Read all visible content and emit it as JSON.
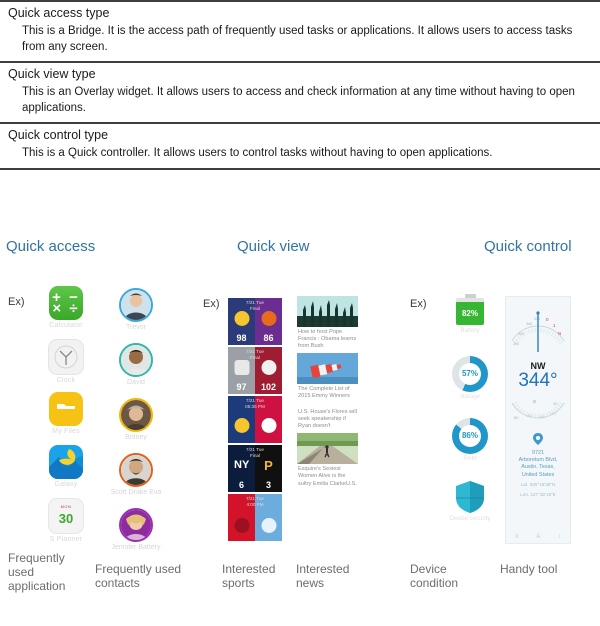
{
  "type_table": {
    "rows": [
      {
        "title": "Quick access type",
        "desc": "This is a Bridge. It is the access path of frequently used tasks or applications. It allows users to access tasks from any screen."
      },
      {
        "title": "Quick view type",
        "desc": "This is an Overlay widget. It allows users to access and check information at any time without having to open applications."
      },
      {
        "title": "Quick control type",
        "desc": "This is a Quick controller. It allows users to control tasks without having to open applications."
      }
    ]
  },
  "headings": {
    "quick_access": "Quick access",
    "quick_view": "Quick view",
    "quick_control": "Quick control"
  },
  "example_labels": {
    "access": "Ex)",
    "view": "Ex)",
    "control": "Ex)"
  },
  "colors": {
    "heading_blue": "#2e75a3",
    "caption_gray": "#6d6d6d",
    "battery_green": "#37b634",
    "ring_blue": "#2196c9",
    "compass_blue": "#1e73be",
    "rule_dark": "#3f3f3f"
  },
  "quick_access": {
    "apps": {
      "caption": "Frequently used application",
      "items": [
        {
          "label": "Calculator",
          "icon": "calculator-icon",
          "glyph": "+ −\n× ÷"
        },
        {
          "label": "Clock",
          "icon": "clock-icon"
        },
        {
          "label": "My Files",
          "icon": "folder-icon"
        },
        {
          "label": "Galaxy",
          "icon": "gallery-icon"
        },
        {
          "label": "S Planner",
          "icon": "calendar-icon",
          "month": "MON",
          "day": "30"
        }
      ]
    },
    "contacts": {
      "caption": "Frequently used contacts",
      "items": [
        {
          "label": "Trevor",
          "icon": "avatar",
          "ring": "#39a9dc"
        },
        {
          "label": "David",
          "icon": "avatar",
          "ring": "#2fb8a8"
        },
        {
          "label": "Britney",
          "icon": "avatar",
          "ring": "#f2b705"
        },
        {
          "label": "Scott Drake Eva",
          "icon": "avatar",
          "ring": "#e2621b"
        },
        {
          "label": "Jennifer Battery",
          "icon": "avatar",
          "ring": "#9b2fae"
        }
      ]
    }
  },
  "quick_view": {
    "sports": {
      "caption": "Interested sports",
      "cards": [
        {
          "date": "7/21 Tue",
          "status": "Final",
          "home": {
            "score": "98",
            "color": "#2b3a78",
            "logo": "#f7c52d"
          },
          "away": {
            "score": "86",
            "color": "#6b2d8f",
            "logo": "#e86a1c"
          }
        },
        {
          "date": "7/21 Tue",
          "status": "Final",
          "home": {
            "score": "97",
            "color": "#9aa0a6",
            "logo": "#e8e8e8"
          },
          "away": {
            "score": "102",
            "color": "#a01c30",
            "logo": "#f0f0f0"
          }
        },
        {
          "date": "7/21 Tue",
          "status": "05:35 PM",
          "home": {
            "score": "",
            "color": "#1d3a7a",
            "logo": "#f7c52d"
          },
          "away": {
            "score": "",
            "color": "#ce1141",
            "logo": "#ffffff"
          }
        },
        {
          "date": "7/21 Tue",
          "status": "Final",
          "home": {
            "score": "6",
            "color": "#0c1c3c",
            "logo": "#ffffff"
          },
          "away": {
            "score": "3",
            "color": "#101010",
            "logo": "#f5b82e"
          }
        },
        {
          "date": "7/21 Tue",
          "status": "4:00 PM",
          "home": {
            "score": "",
            "color": "#d2132a",
            "logo": "#9c1021"
          },
          "away": {
            "score": "",
            "color": "#6cadde",
            "logo": "#e8f2fa"
          }
        }
      ]
    },
    "news": {
      "caption": "Interested news",
      "items": [
        {
          "headline": "How to host Pope Francis : Obama learns from Bush",
          "has_image": true,
          "image": "crowd-hands-photo"
        },
        {
          "headline": "The Complete List of 2015 Emmy Winners",
          "has_image": true,
          "image": "windsock-photo"
        },
        {
          "headline": "U.S. House's Flores will seek speakership if Ryan doesn't",
          "has_image": false
        },
        {
          "headline": "Esquire's Sexiest Women Alive is the sultry Emilia ClarkeU.S.",
          "has_image": true,
          "image": "runner-road-photo"
        }
      ]
    }
  },
  "quick_control": {
    "device": {
      "caption": "Device condition",
      "items": [
        {
          "label": "Battery",
          "value": "82%",
          "icon": "battery-icon",
          "percent": 82
        },
        {
          "label": "storage",
          "value": "57%",
          "icon": "ring-gauge-icon",
          "percent": 57
        },
        {
          "label": "RAM",
          "value": "86%",
          "icon": "ring-gauge-icon",
          "percent": 86
        },
        {
          "label": "Device security",
          "value": "",
          "icon": "shield-icon",
          "percent": 0
        }
      ]
    },
    "handy": {
      "caption": "Handy tool",
      "compass": {
        "direction": "NW",
        "degrees": "344°",
        "ticks_top": [
          "330",
          "340",
          "350",
          "N",
          "10",
          "20"
        ],
        "ticks_bottom": [
          "S",
          "30",
          "60"
        ]
      },
      "location": {
        "icon": "map-pin-icon",
        "number": "9721",
        "street": "Arboretum Blvd,",
        "city": "Austin, Texas,",
        "country": "United States",
        "lat": "Lat. 030°15'38\"N",
        "lon": "Lon. 127°32'19\"E"
      },
      "toolbar": [
        "≡",
        "A",
        "↕"
      ]
    }
  }
}
